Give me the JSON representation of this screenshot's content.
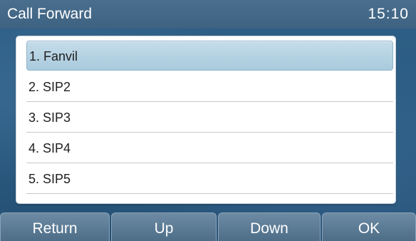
{
  "header": {
    "title": "Call Forward",
    "time": "15:10"
  },
  "lines": {
    "selected_index": 0,
    "items": [
      {
        "label": "1. Fanvil"
      },
      {
        "label": "2. SIP2"
      },
      {
        "label": "3. SIP3"
      },
      {
        "label": "4. SIP4"
      },
      {
        "label": "5. SIP5"
      }
    ]
  },
  "softkeys": {
    "return_label": "Return",
    "up_label": "Up",
    "down_label": "Down",
    "ok_label": "OK"
  },
  "colors": {
    "background": "#2b5b82",
    "titlebar": "#466b8a",
    "selection": "#b8d4e4",
    "softkey": "#5c7c96"
  }
}
